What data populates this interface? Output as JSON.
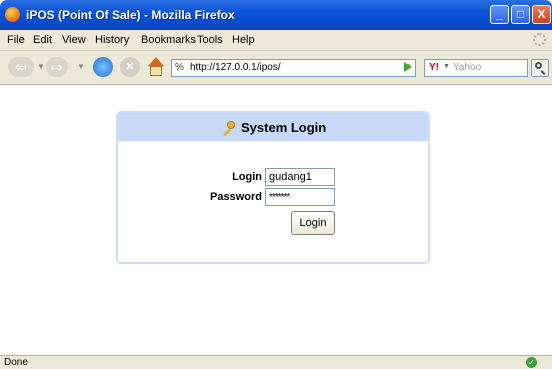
{
  "window": {
    "title": "iPOS (Point Of Sale) - Mozilla Firefox",
    "minimize_glyph": "_",
    "maximize_glyph": "□",
    "close_glyph": "X"
  },
  "menu": {
    "items": [
      {
        "label": "File"
      },
      {
        "label": "Edit"
      },
      {
        "label": "View"
      },
      {
        "label": "History"
      },
      {
        "label": "Bookmarks"
      },
      {
        "label": "Tools"
      },
      {
        "label": "Help"
      }
    ]
  },
  "toolbar": {
    "url": "http://127.0.0.1/ipos/",
    "search_placeholder": "Yahoo",
    "search_engine_logo": "Y!",
    "icons": [
      "back-icon",
      "forward-icon",
      "reload-icon",
      "stop-icon",
      "home-icon",
      "go-icon",
      "search-icon"
    ]
  },
  "login": {
    "title": "System Login",
    "login_label": "Login",
    "login_value": "gudang1",
    "password_label": "Password",
    "password_value": "*******",
    "submit_label": "Login"
  },
  "status": {
    "text": "Done"
  },
  "colors": {
    "titlebar": "#0a53d8",
    "panel_header": "#c6d9f6",
    "panel_border": "#d0def5"
  }
}
